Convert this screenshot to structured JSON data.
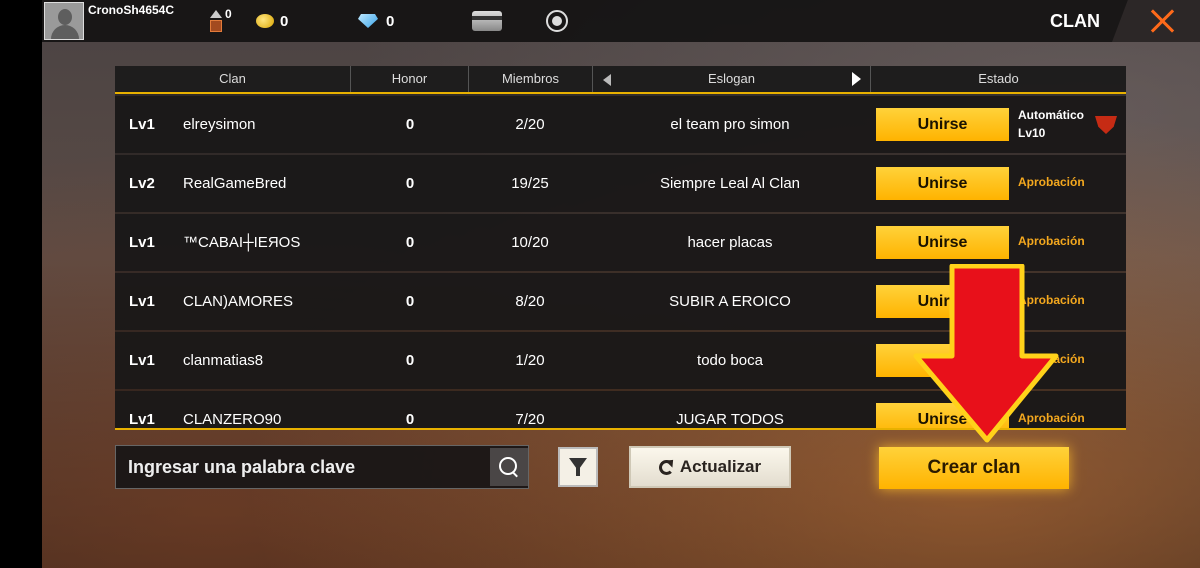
{
  "topbar": {
    "username": "CronoSh4654C",
    "rank_count": "0",
    "coins": "0",
    "diamonds": "0",
    "screen_title": "CLAN"
  },
  "table": {
    "headers": [
      "Clan",
      "Honor",
      "Miembros",
      "Eslogan",
      "Estado"
    ],
    "rows": [
      {
        "level": "Lv1",
        "name": "elreysimon",
        "honor": "0",
        "members": "2/20",
        "slogan": "el team pro simon",
        "join_label": "Unirse",
        "status_line1": "Automático",
        "status_line2": "Lv10",
        "status_type": "auto"
      },
      {
        "level": "Lv2",
        "name": "RealGameBred",
        "honor": "0",
        "members": "19/25",
        "slogan": "Siempre Leal Al Clan",
        "join_label": "Unirse",
        "status_line1": "Aprobación",
        "status_type": "approval"
      },
      {
        "level": "Lv1",
        "name": "™CABAI┼IEЯOS",
        "honor": "0",
        "members": "10/20",
        "slogan": "hacer placas",
        "join_label": "Unirse",
        "status_line1": "Aprobación",
        "status_type": "approval"
      },
      {
        "level": "Lv1",
        "name": "CLAN)AMORES",
        "honor": "0",
        "members": "8/20",
        "slogan": "SUBIR A EROICO",
        "join_label": "Unirse",
        "status_line1": "Aprobación",
        "status_type": "approval"
      },
      {
        "level": "Lv1",
        "name": "clanmatias8",
        "honor": "0",
        "members": "1/20",
        "slogan": "todo boca",
        "join_label": "Unirse",
        "status_line1": "Aprobación",
        "status_type": "approval"
      },
      {
        "level": "Lv1",
        "name": "CLANZERO90",
        "honor": "0",
        "members": "7/20",
        "slogan": "JUGAR TODOS",
        "join_label": "Unirse",
        "status_line1": "Aprobación",
        "status_type": "approval"
      }
    ]
  },
  "search": {
    "placeholder": "Ingresar una palabra clave"
  },
  "buttons": {
    "refresh_label": "Actualizar",
    "create_label": "Crear clan"
  },
  "colors": {
    "accent": "#ffc21a",
    "approval": "#f4a81e",
    "close": "#ff6a1a",
    "arrow": "#e8101a"
  }
}
